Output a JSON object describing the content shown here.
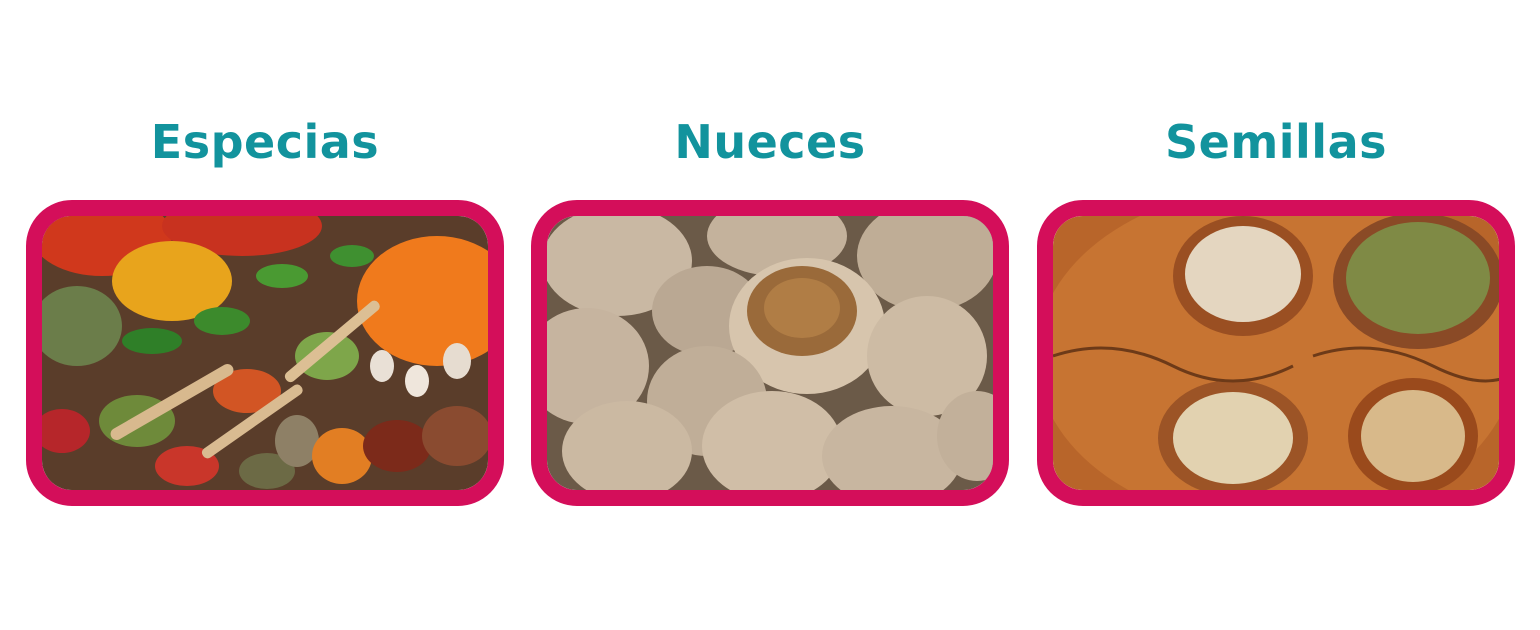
{
  "colors": {
    "title": "#12939d",
    "frame": "#d40e5a",
    "background": "#ffffff"
  },
  "cards": [
    {
      "title": "Especias",
      "image": "spices-photo"
    },
    {
      "title": "Nueces",
      "image": "walnuts-photo"
    },
    {
      "title": "Semillas",
      "image": "seeds-photo"
    }
  ]
}
